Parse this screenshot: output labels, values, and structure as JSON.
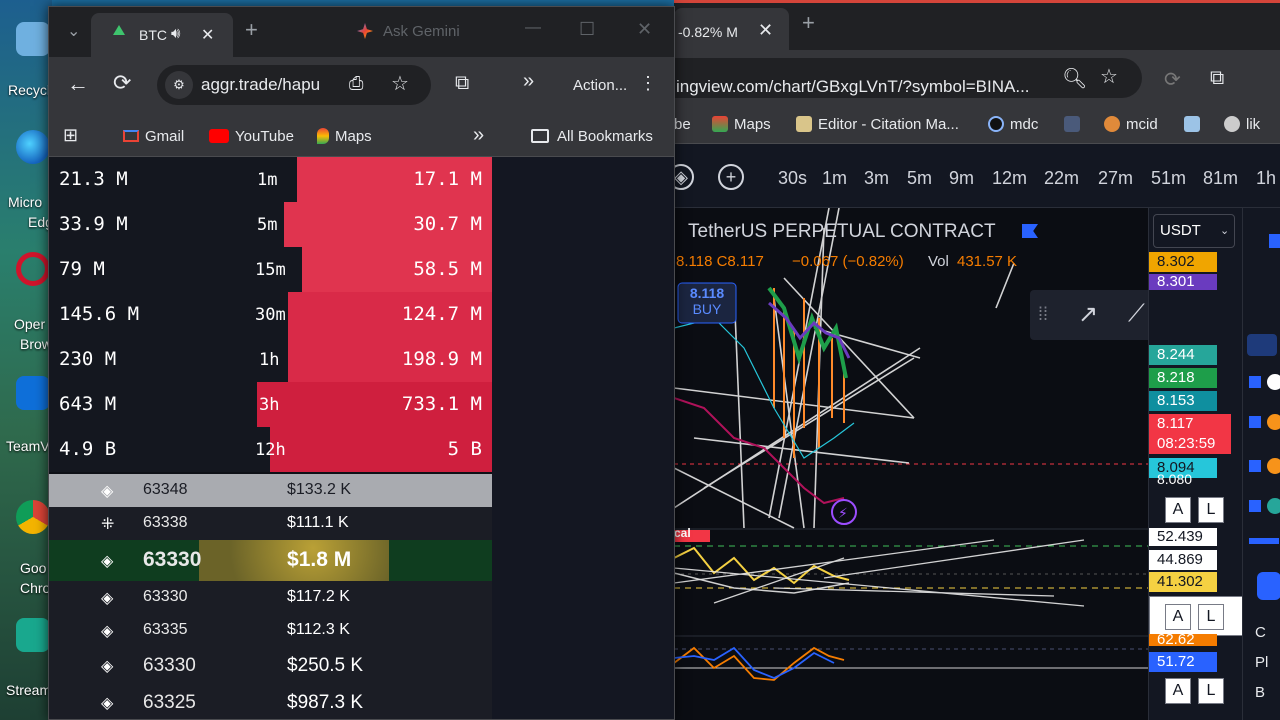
{
  "desktop": {
    "icons": [
      {
        "label": "Recycl",
        "color": "#5aa0d8"
      },
      {
        "label": "Micro",
        "label2": "Edg",
        "color": "#1f8fd6"
      },
      {
        "label": "Oper",
        "label2": "Brow",
        "color": "#c0142b"
      },
      {
        "label": "TeamV",
        "color": "#0e6fd9"
      },
      {
        "label": "Goo",
        "label2": "Chro",
        "color": "#e8e8e8"
      },
      {
        "label": "Stream",
        "color": "#1aa38a"
      }
    ]
  },
  "left_browser": {
    "tab": {
      "title": "BTC",
      "audio_icon": "speaker-icon",
      "close_icon": "close-icon"
    },
    "gemini_tab": "Ask Gemini",
    "url": "aggr.trade/hapu",
    "actions_label": "Action...",
    "bookmarks": [
      "Gmail",
      "YouTube",
      "Maps"
    ],
    "all_bookmarks": "All Bookmarks"
  },
  "stats": [
    {
      "buy": "21.3 M",
      "period": "1m",
      "sell": "17.1 M",
      "sell_fraction": 0.44
    },
    {
      "buy": "33.9 M",
      "period": "5m",
      "sell": "30.7 M",
      "sell_fraction": 0.47
    },
    {
      "buy": "79 M",
      "period": "15m",
      "sell": "58.5 M",
      "sell_fraction": 0.43
    },
    {
      "buy": "145.6 M",
      "period": "30m",
      "sell": "124.7 M",
      "sell_fraction": 0.46
    },
    {
      "buy": "230 M",
      "period": "1h",
      "sell": "198.9 M",
      "sell_fraction": 0.46
    },
    {
      "buy": "643 M",
      "period": "3h",
      "sell": "733.1 M",
      "sell_fraction": 0.53
    },
    {
      "buy": "4.9 B",
      "period": "12h",
      "sell": "5 B",
      "sell_fraction": 0.5
    }
  ],
  "trades": [
    {
      "exchange_icon": "binance-icon",
      "price": "63348",
      "amount": "133.2 K",
      "style": "highlight"
    },
    {
      "exchange_icon": "okx-icon",
      "price": "63338",
      "amount": "111.1 K",
      "style": "normal"
    },
    {
      "exchange_icon": "binance-icon",
      "price": "63330",
      "amount": "1.8 M",
      "style": "big"
    },
    {
      "exchange_icon": "binance-icon",
      "price": "63330",
      "amount": "117.2 K",
      "style": "normal"
    },
    {
      "exchange_icon": "binance-icon",
      "price": "63335",
      "amount": "112.3 K",
      "style": "normal"
    },
    {
      "exchange_icon": "binance-icon",
      "price": "63330",
      "amount": "250.5 K",
      "style": "medium"
    },
    {
      "exchange_icon": "binance-icon",
      "price": "63325",
      "amount": "987.3 K",
      "style": "medium"
    }
  ],
  "currency_symbol": "$",
  "right_browser": {
    "tab_title": "-0.82% M",
    "url": "ingview.com/chart/GBxgLVnT/?symbol=BINA...",
    "bookmarks": [
      "be",
      "Maps",
      "Editor - Citation Ma...",
      "mdc",
      "mcid",
      "lik"
    ],
    "timeframes": [
      "30s",
      "1m",
      "3m",
      "5m",
      "9m",
      "12m",
      "22m",
      "27m",
      "51m",
      "81m",
      "1h"
    ],
    "symbol_title": "TetherUS PERPETUAL CONTRACT",
    "ohlc_text": "8.118 C8.117",
    "change_text": "−0.067 (−0.82%)",
    "vol_label": "Vol",
    "vol_value": "431.57 K",
    "buy_price": "8.118",
    "buy_label": "BUY",
    "currency_select": "USDT",
    "indicator_tag": "cal",
    "price_labels": [
      {
        "text": "8.302",
        "bg": "#f0a500",
        "fg": "#131722"
      },
      {
        "text": "8.301",
        "bg": "#6a3bbf",
        "fg": "#ffffff"
      },
      {
        "text": "8.244",
        "bg": "#26a69a",
        "fg": "#ffffff"
      },
      {
        "text": "8.218",
        "bg": "#1e9e4a",
        "fg": "#ffffff"
      },
      {
        "text": "8.153",
        "bg": "#0f8f9f",
        "fg": "#ffffff"
      },
      {
        "text": "8.117",
        "bg": "#f23645",
        "fg": "#ffffff"
      },
      {
        "text": "08:23:59",
        "bg": "#f23645",
        "fg": "#ffffff"
      },
      {
        "text": "8.094",
        "bg": "#26c6da",
        "fg": "#131722"
      },
      {
        "text": "8.080",
        "bg": "#131722",
        "fg": "#ffffff"
      }
    ],
    "osc_labels": [
      {
        "text": "52.439",
        "bg": "#ffffff",
        "fg": "#131722"
      },
      {
        "text": "44.869",
        "bg": "#ffffff",
        "fg": "#131722"
      },
      {
        "text": "41.302",
        "bg": "#f5d142",
        "fg": "#131722"
      }
    ],
    "rsi_labels": [
      {
        "text": "62.62",
        "bg": "#f57c00",
        "fg": "#ffffff"
      },
      {
        "text": "51.72",
        "bg": "#2962ff",
        "fg": "#ffffff"
      }
    ],
    "axis_buttons": [
      "A",
      "L"
    ],
    "right_letters": [
      "C",
      "Pl",
      "B"
    ]
  }
}
